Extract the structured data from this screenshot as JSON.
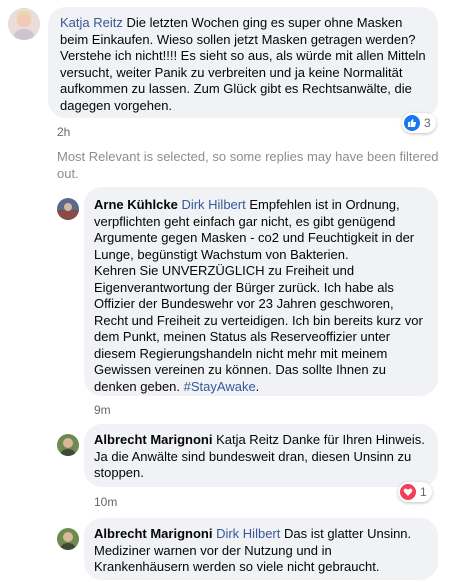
{
  "comments": [
    {
      "author": "Katja Reitz",
      "text": "Die letzten Wochen ging es super ohne Masken beim Einkaufen. Wieso sollen jetzt Masken getragen werden? Verstehe ich nicht!!!! Es sieht so aus, als würde mit allen Mitteln versucht, weiter Panik zu verbreiten und ja keine Normalität aufkommen zu lassen. Zum Glück gibt es Rechtsanwälte, die dagegen vorgehen.",
      "time": "2h",
      "reaction": {
        "icon": "like-icon",
        "count": "3",
        "color": "#1877f2"
      }
    }
  ],
  "filter_notice": "Most Relevant is selected, so some replies may have been filtered out.",
  "replies": [
    {
      "author": "Arne Kühlcke",
      "mention": "Dirk Hilbert",
      "text_a": " Empfehlen ist in Ordnung, verpflichten geht einfach gar nicht, es gibt genügend Argumente gegen Masken - co2 und Feuchtigkeit in der Lunge, begünstigt Wachstum von Bakterien.",
      "text_b": "Kehren Sie UNVERZÜGLICH zu Freiheit und Eigenverantwortung der Bürger zurück. Ich habe als Offizier der Bundeswehr vor 23 Jahren geschworen, Recht und Freiheit zu verteidigen. Ich bin bereits kurz vor dem Punkt, meinen Status als Reserveoffizier unter diesem Regierungshandeln nicht mehr mit meinem Gewissen vereinen zu können. Das sollte Ihnen zu denken geben. ",
      "hashtag": "#StayAwake",
      "text_c": ".",
      "time": "9m"
    },
    {
      "author": "Albrecht Marignoni",
      "text": " Katja Reitz Danke für Ihren Hinweis. Ja die Anwälte sind bundesweit dran, diesen Unsinn zu stoppen.",
      "time": "10m",
      "reaction": {
        "icon": "love-icon",
        "count": "1",
        "color": "#f33e58"
      }
    },
    {
      "author": "Albrecht Marignoni",
      "mention": "Dirk Hilbert",
      "text": " Das ist glatter Unsinn. Mediziner warnen vor der Nutzung und in Krankenhäusern werden so viele nicht gebraucht."
    }
  ]
}
